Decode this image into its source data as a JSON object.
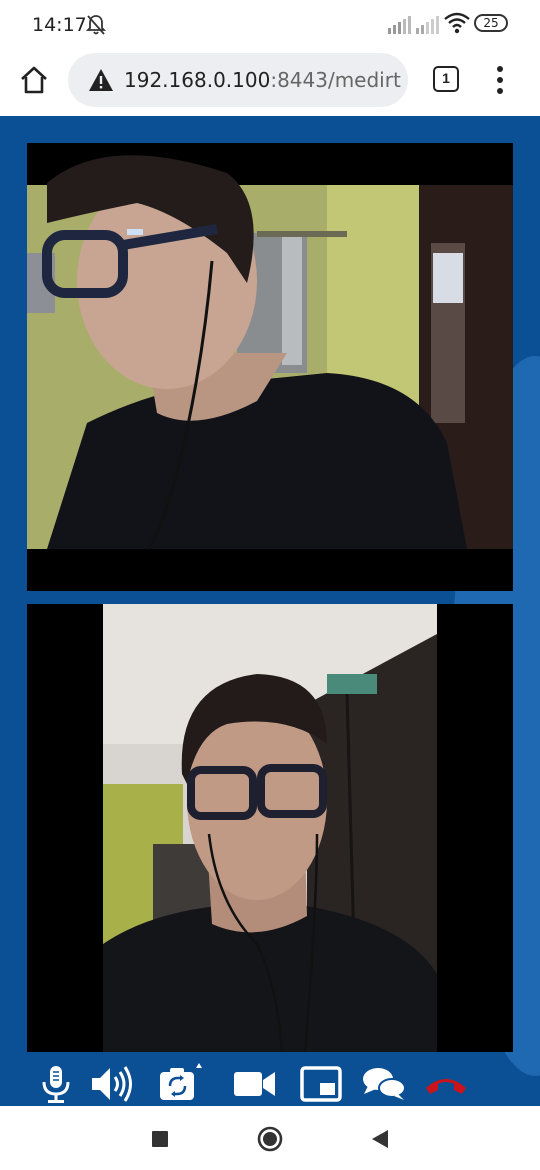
{
  "status_bar": {
    "time": "14:17",
    "battery": "25",
    "icons": [
      "bell-off-icon",
      "signal-icon",
      "signal-icon",
      "wifi-icon",
      "battery-icon"
    ]
  },
  "browser": {
    "url_host": "192.168.0.100",
    "url_port_path": ":8443/medirt",
    "tab_count": "1",
    "icons": [
      "home-icon",
      "warning-icon",
      "tabs-icon",
      "overflow-menu-icon"
    ]
  },
  "call": {
    "controls": [
      {
        "name": "microphone",
        "icon": "microphone-icon"
      },
      {
        "name": "speaker",
        "icon": "speaker-icon"
      },
      {
        "name": "switch-camera",
        "icon": "switch-camera-icon"
      },
      {
        "name": "video",
        "icon": "video-camera-icon"
      },
      {
        "name": "picture-in-picture",
        "icon": "picture-in-picture-icon"
      },
      {
        "name": "chat",
        "icon": "chat-icon"
      },
      {
        "name": "end-call",
        "icon": "end-call-icon"
      }
    ],
    "end_call_color": "#c8141a",
    "background_color": "#0b4f94"
  },
  "navigation": {
    "icons": [
      "recents-icon",
      "home-circle-icon",
      "back-icon"
    ]
  }
}
